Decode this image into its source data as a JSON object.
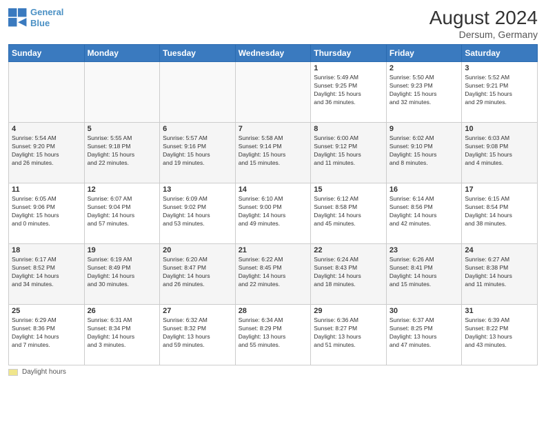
{
  "header": {
    "logo_line1": "General",
    "logo_line2": "Blue",
    "month_title": "August 2024",
    "location": "Dersum, Germany"
  },
  "days_of_week": [
    "Sunday",
    "Monday",
    "Tuesday",
    "Wednesday",
    "Thursday",
    "Friday",
    "Saturday"
  ],
  "legend": {
    "label": "Daylight hours"
  },
  "weeks": [
    {
      "days": [
        {
          "num": "",
          "info": ""
        },
        {
          "num": "",
          "info": ""
        },
        {
          "num": "",
          "info": ""
        },
        {
          "num": "",
          "info": ""
        },
        {
          "num": "1",
          "info": "Sunrise: 5:49 AM\nSunset: 9:25 PM\nDaylight: 15 hours\nand 36 minutes."
        },
        {
          "num": "2",
          "info": "Sunrise: 5:50 AM\nSunset: 9:23 PM\nDaylight: 15 hours\nand 32 minutes."
        },
        {
          "num": "3",
          "info": "Sunrise: 5:52 AM\nSunset: 9:21 PM\nDaylight: 15 hours\nand 29 minutes."
        }
      ]
    },
    {
      "days": [
        {
          "num": "4",
          "info": "Sunrise: 5:54 AM\nSunset: 9:20 PM\nDaylight: 15 hours\nand 26 minutes."
        },
        {
          "num": "5",
          "info": "Sunrise: 5:55 AM\nSunset: 9:18 PM\nDaylight: 15 hours\nand 22 minutes."
        },
        {
          "num": "6",
          "info": "Sunrise: 5:57 AM\nSunset: 9:16 PM\nDaylight: 15 hours\nand 19 minutes."
        },
        {
          "num": "7",
          "info": "Sunrise: 5:58 AM\nSunset: 9:14 PM\nDaylight: 15 hours\nand 15 minutes."
        },
        {
          "num": "8",
          "info": "Sunrise: 6:00 AM\nSunset: 9:12 PM\nDaylight: 15 hours\nand 11 minutes."
        },
        {
          "num": "9",
          "info": "Sunrise: 6:02 AM\nSunset: 9:10 PM\nDaylight: 15 hours\nand 8 minutes."
        },
        {
          "num": "10",
          "info": "Sunrise: 6:03 AM\nSunset: 9:08 PM\nDaylight: 15 hours\nand 4 minutes."
        }
      ]
    },
    {
      "days": [
        {
          "num": "11",
          "info": "Sunrise: 6:05 AM\nSunset: 9:06 PM\nDaylight: 15 hours\nand 0 minutes."
        },
        {
          "num": "12",
          "info": "Sunrise: 6:07 AM\nSunset: 9:04 PM\nDaylight: 14 hours\nand 57 minutes."
        },
        {
          "num": "13",
          "info": "Sunrise: 6:09 AM\nSunset: 9:02 PM\nDaylight: 14 hours\nand 53 minutes."
        },
        {
          "num": "14",
          "info": "Sunrise: 6:10 AM\nSunset: 9:00 PM\nDaylight: 14 hours\nand 49 minutes."
        },
        {
          "num": "15",
          "info": "Sunrise: 6:12 AM\nSunset: 8:58 PM\nDaylight: 14 hours\nand 45 minutes."
        },
        {
          "num": "16",
          "info": "Sunrise: 6:14 AM\nSunset: 8:56 PM\nDaylight: 14 hours\nand 42 minutes."
        },
        {
          "num": "17",
          "info": "Sunrise: 6:15 AM\nSunset: 8:54 PM\nDaylight: 14 hours\nand 38 minutes."
        }
      ]
    },
    {
      "days": [
        {
          "num": "18",
          "info": "Sunrise: 6:17 AM\nSunset: 8:52 PM\nDaylight: 14 hours\nand 34 minutes."
        },
        {
          "num": "19",
          "info": "Sunrise: 6:19 AM\nSunset: 8:49 PM\nDaylight: 14 hours\nand 30 minutes."
        },
        {
          "num": "20",
          "info": "Sunrise: 6:20 AM\nSunset: 8:47 PM\nDaylight: 14 hours\nand 26 minutes."
        },
        {
          "num": "21",
          "info": "Sunrise: 6:22 AM\nSunset: 8:45 PM\nDaylight: 14 hours\nand 22 minutes."
        },
        {
          "num": "22",
          "info": "Sunrise: 6:24 AM\nSunset: 8:43 PM\nDaylight: 14 hours\nand 18 minutes."
        },
        {
          "num": "23",
          "info": "Sunrise: 6:26 AM\nSunset: 8:41 PM\nDaylight: 14 hours\nand 15 minutes."
        },
        {
          "num": "24",
          "info": "Sunrise: 6:27 AM\nSunset: 8:38 PM\nDaylight: 14 hours\nand 11 minutes."
        }
      ]
    },
    {
      "days": [
        {
          "num": "25",
          "info": "Sunrise: 6:29 AM\nSunset: 8:36 PM\nDaylight: 14 hours\nand 7 minutes."
        },
        {
          "num": "26",
          "info": "Sunrise: 6:31 AM\nSunset: 8:34 PM\nDaylight: 14 hours\nand 3 minutes."
        },
        {
          "num": "27",
          "info": "Sunrise: 6:32 AM\nSunset: 8:32 PM\nDaylight: 13 hours\nand 59 minutes."
        },
        {
          "num": "28",
          "info": "Sunrise: 6:34 AM\nSunset: 8:29 PM\nDaylight: 13 hours\nand 55 minutes."
        },
        {
          "num": "29",
          "info": "Sunrise: 6:36 AM\nSunset: 8:27 PM\nDaylight: 13 hours\nand 51 minutes."
        },
        {
          "num": "30",
          "info": "Sunrise: 6:37 AM\nSunset: 8:25 PM\nDaylight: 13 hours\nand 47 minutes."
        },
        {
          "num": "31",
          "info": "Sunrise: 6:39 AM\nSunset: 8:22 PM\nDaylight: 13 hours\nand 43 minutes."
        }
      ]
    }
  ]
}
